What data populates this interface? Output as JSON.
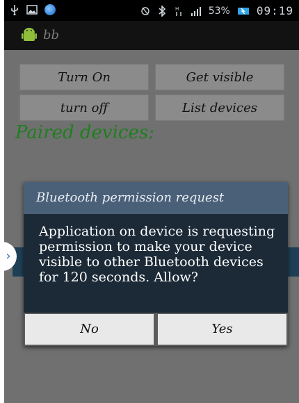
{
  "status": {
    "battery": "53%",
    "time": "09:19"
  },
  "app": {
    "title": "bb"
  },
  "buttons": {
    "turn_on": "Turn On",
    "get_visible": "Get visible",
    "turn_off": "turn off",
    "list_devices": "List devices"
  },
  "paired_label": "Paired devices:",
  "dialog": {
    "title": "Bluetooth permission request",
    "message": "Application on device is requesting permission to make your device visible to other Bluetooth devices for 120 seconds. Allow?",
    "no": "No",
    "yes": "Yes"
  },
  "icons": [
    "usb-icon",
    "image-icon",
    "browser-icon",
    "mute-icon",
    "bluetooth-icon",
    "data-icon",
    "signal-icon",
    "battery-icon",
    "android-app-icon",
    "chevron-right-icon"
  ]
}
